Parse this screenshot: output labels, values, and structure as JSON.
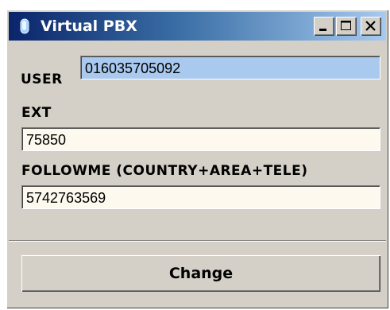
{
  "window": {
    "title": "Virtual PBX"
  },
  "titlebar_buttons": [
    "minimize",
    "maximize",
    "close"
  ],
  "form": {
    "user_label": "USER",
    "user_value": "016035705092",
    "ext_label": "EXT",
    "ext_value": "75850",
    "followme_label": "FOLLOWME (COUNTRY+AREA+TELE)",
    "followme_value": "5742763569"
  },
  "actions": {
    "change_label": "Change"
  },
  "colors": {
    "titlebar_start": "#0a246a",
    "titlebar_end": "#a6caf0",
    "window_bg": "#d4d0c8",
    "field_bg": "#fdf9ee",
    "selected_field_bg": "#a9c9ef"
  },
  "icons": {
    "app": "virtual-pbx-app-icon"
  }
}
